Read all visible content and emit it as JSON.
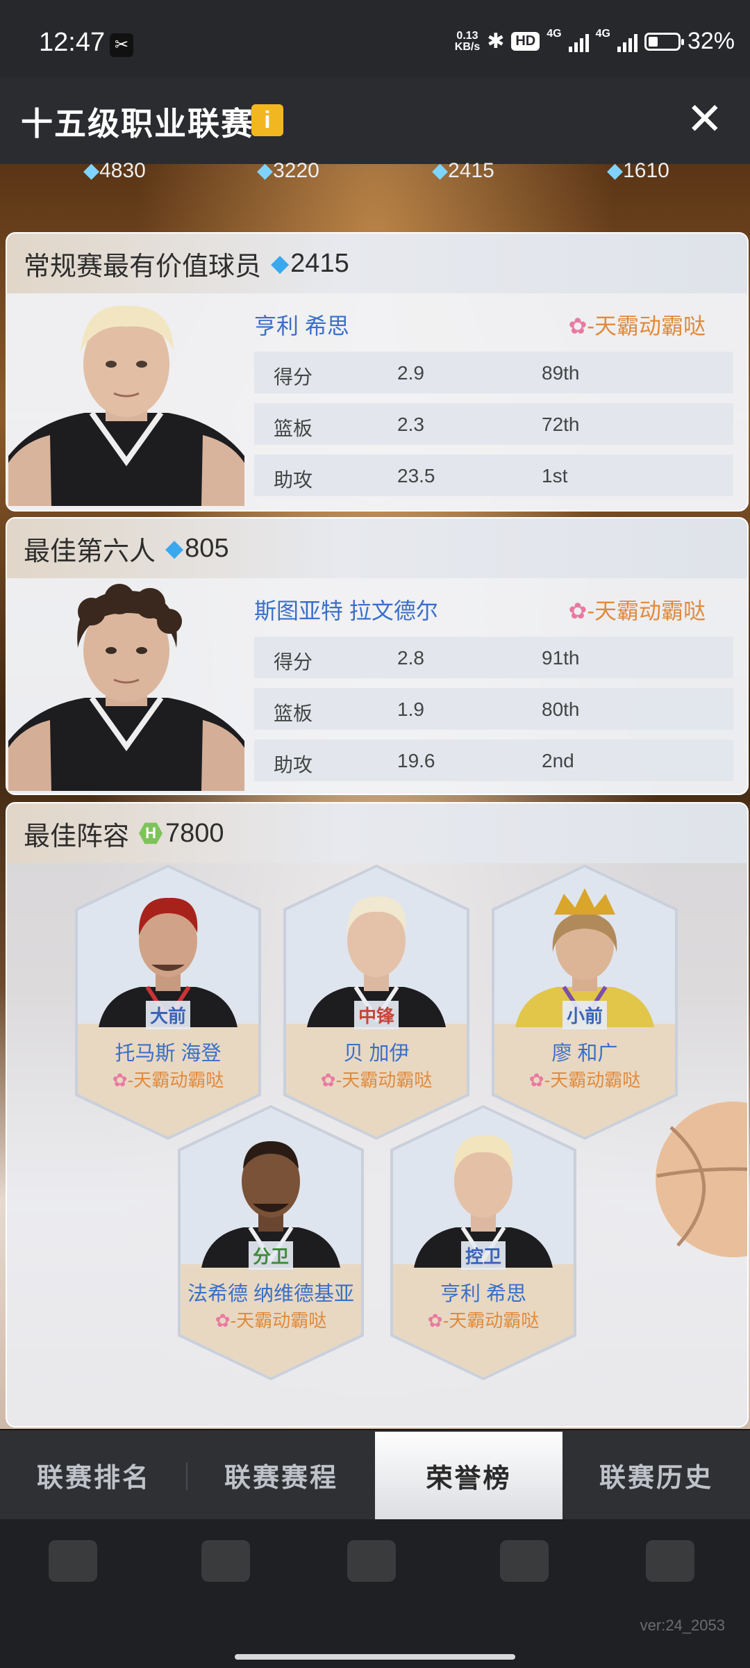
{
  "status_bar": {
    "time": "12:47",
    "net_speed_top": "0.13",
    "net_speed_unit": "KB/s",
    "hd_label": "HD",
    "signal1_label": "4G",
    "signal2_label": "4G",
    "battery_percent": "32%",
    "battery_level": 0.32
  },
  "header": {
    "title": "十五级职业联赛",
    "info_icon": "i",
    "close_icon": "✕"
  },
  "prizes": [
    "4830",
    "3220",
    "2415",
    "1610"
  ],
  "mvp": {
    "title": "常规赛最有价值球员",
    "reward": "2415",
    "player_name": "亨利 希思",
    "team": "-天霸动霸哒",
    "stats": [
      {
        "label": "得分",
        "value": "2.9",
        "rank": "89th"
      },
      {
        "label": "篮板",
        "value": "2.3",
        "rank": "72th"
      },
      {
        "label": "助攻",
        "value": "23.5",
        "rank": "1st"
      }
    ]
  },
  "sixth_man": {
    "title": "最佳第六人",
    "reward": "805",
    "player_name": "斯图亚特 拉文德尔",
    "team": "-天霸动霸哒",
    "stats": [
      {
        "label": "得分",
        "value": "2.8",
        "rank": "91th"
      },
      {
        "label": "篮板",
        "value": "1.9",
        "rank": "80th"
      },
      {
        "label": "助攻",
        "value": "19.6",
        "rank": "2nd"
      }
    ]
  },
  "lineup": {
    "title": "最佳阵容",
    "reward": "7800",
    "reward_icon": "H",
    "players": [
      {
        "position": "大前",
        "name": "托马斯 海登",
        "team": "-天霸动霸哒"
      },
      {
        "position": "中锋",
        "name": "贝 加伊",
        "team": "-天霸动霸哒"
      },
      {
        "position": "小前",
        "name": "廖 和广",
        "team": "-天霸动霸哒"
      },
      {
        "position": "分卫",
        "name": "法希德 纳维德基亚",
        "team": "-天霸动霸哒"
      },
      {
        "position": "控卫",
        "name": "亨利 希思",
        "team": "-天霸动霸哒"
      }
    ]
  },
  "tabs": [
    "联赛排名",
    "联赛赛程",
    "荣誉榜",
    "联赛历史"
  ],
  "active_tab": 2,
  "version": "ver:24_2053",
  "colors": {
    "name_blue": "#3a6fc8",
    "team_orange": "#e08a3c",
    "gem_blue": "#3aa8ef",
    "info_yellow": "#f2b720"
  }
}
